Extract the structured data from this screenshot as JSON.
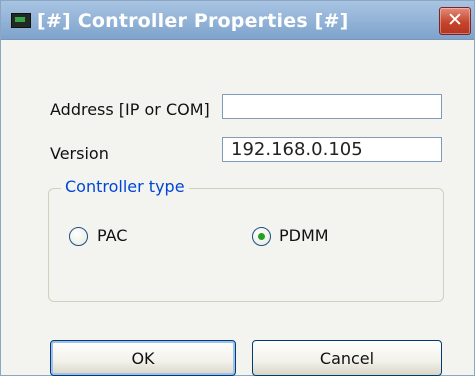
{
  "window": {
    "title": "[#] Controller Properties [#]",
    "close_symbol": "✕",
    "icon": "controller-app-icon",
    "close_color": "#c7452d"
  },
  "form": {
    "address_label": "Address [IP or COM]",
    "address_value": "",
    "version_label": "Version",
    "version_value": "192.168.0.105"
  },
  "controller_type": {
    "legend": "Controller type",
    "options": [
      {
        "label": "PAC",
        "selected": false
      },
      {
        "label": "PDMM",
        "selected": true
      }
    ]
  },
  "buttons": {
    "ok": "OK",
    "cancel": "Cancel"
  }
}
